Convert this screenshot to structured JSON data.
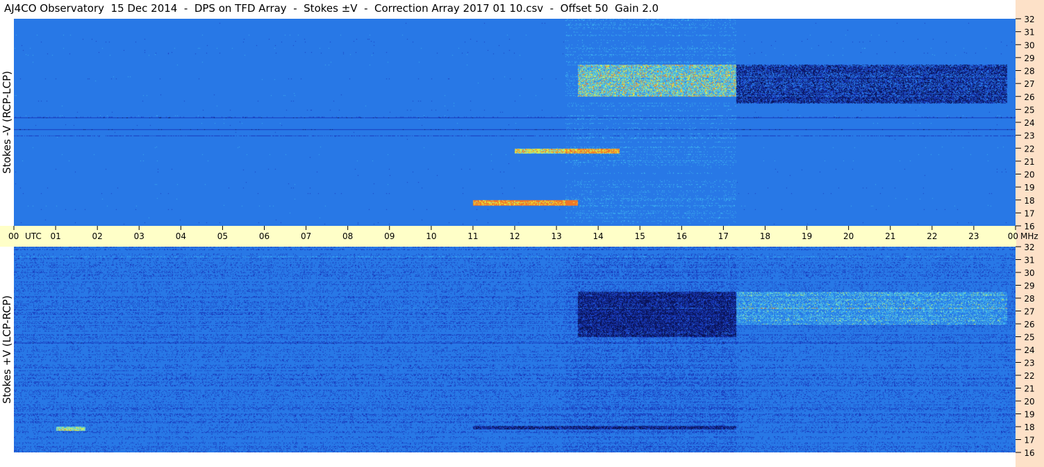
{
  "title": "AJ4CO Observatory  15 Dec 2014  -  DPS on TFD Array  -  Stokes ±V  -  Correction Array 2017 01 10.csv  -  Offset 50  Gain 2.0",
  "colors": {
    "background_blue": "#2a7fe6",
    "dark_blue": "#1a4cc2",
    "bright_cyan": "#3fb4f0",
    "yellow": "#f0f040",
    "timebar": "#ffffc8",
    "freqbar": "#fde1c8"
  },
  "chart_data": [
    {
      "type": "heatmap",
      "panel": "top",
      "ylabel": "Stokes -V (RCP-LCP)",
      "y_ticks": [
        "16",
        "17",
        "18",
        "19",
        "20",
        "21",
        "22",
        "23",
        "24",
        "25",
        "26",
        "27",
        "28",
        "29",
        "30",
        "31",
        "32"
      ],
      "ylim": [
        16,
        32
      ],
      "xlim": [
        0,
        24
      ],
      "activity_regions": [
        {
          "t_start": 13.5,
          "t_end": 17.3,
          "f_low": 26.0,
          "f_high": 28.5,
          "level": "yellow-cyan"
        },
        {
          "t_start": 17.3,
          "t_end": 23.8,
          "f_low": 25.5,
          "f_high": 28.5,
          "level": "dark"
        },
        {
          "t_start": 12.0,
          "t_end": 14.5,
          "f_low": 21.6,
          "f_high": 22.0,
          "level": "yellow"
        },
        {
          "t_start": 11.0,
          "t_end": 13.5,
          "f_low": 17.6,
          "f_high": 18.0,
          "level": "orange"
        }
      ]
    },
    {
      "type": "heatmap",
      "panel": "bottom",
      "ylabel": "Stokes +V (LCP-RCP)",
      "y_ticks": [
        "16",
        "17",
        "18",
        "19",
        "20",
        "21",
        "22",
        "23",
        "24",
        "25",
        "26",
        "27",
        "28",
        "29",
        "30",
        "31",
        "32"
      ],
      "ylim": [
        16,
        32
      ],
      "xlim": [
        0,
        24
      ],
      "activity_regions": [
        {
          "t_start": 13.5,
          "t_end": 17.3,
          "f_low": 25.0,
          "f_high": 28.5,
          "level": "dark"
        },
        {
          "t_start": 17.3,
          "t_end": 23.8,
          "f_low": 26.0,
          "f_high": 28.5,
          "level": "yellow-cyan"
        },
        {
          "t_start": 11.0,
          "t_end": 17.3,
          "f_low": 17.8,
          "f_high": 18.1,
          "level": "dark"
        },
        {
          "t_start": 1.0,
          "t_end": 1.7,
          "f_low": 17.7,
          "f_high": 18.0,
          "level": "yellow"
        }
      ]
    }
  ],
  "time_axis": {
    "ticks": [
      "00",
      "01",
      "02",
      "03",
      "04",
      "05",
      "06",
      "07",
      "08",
      "09",
      "10",
      "11",
      "12",
      "13",
      "14",
      "15",
      "16",
      "17",
      "18",
      "19",
      "20",
      "21",
      "22",
      "23",
      "00"
    ],
    "unit_left": "UTC",
    "unit_right": "MHz"
  }
}
